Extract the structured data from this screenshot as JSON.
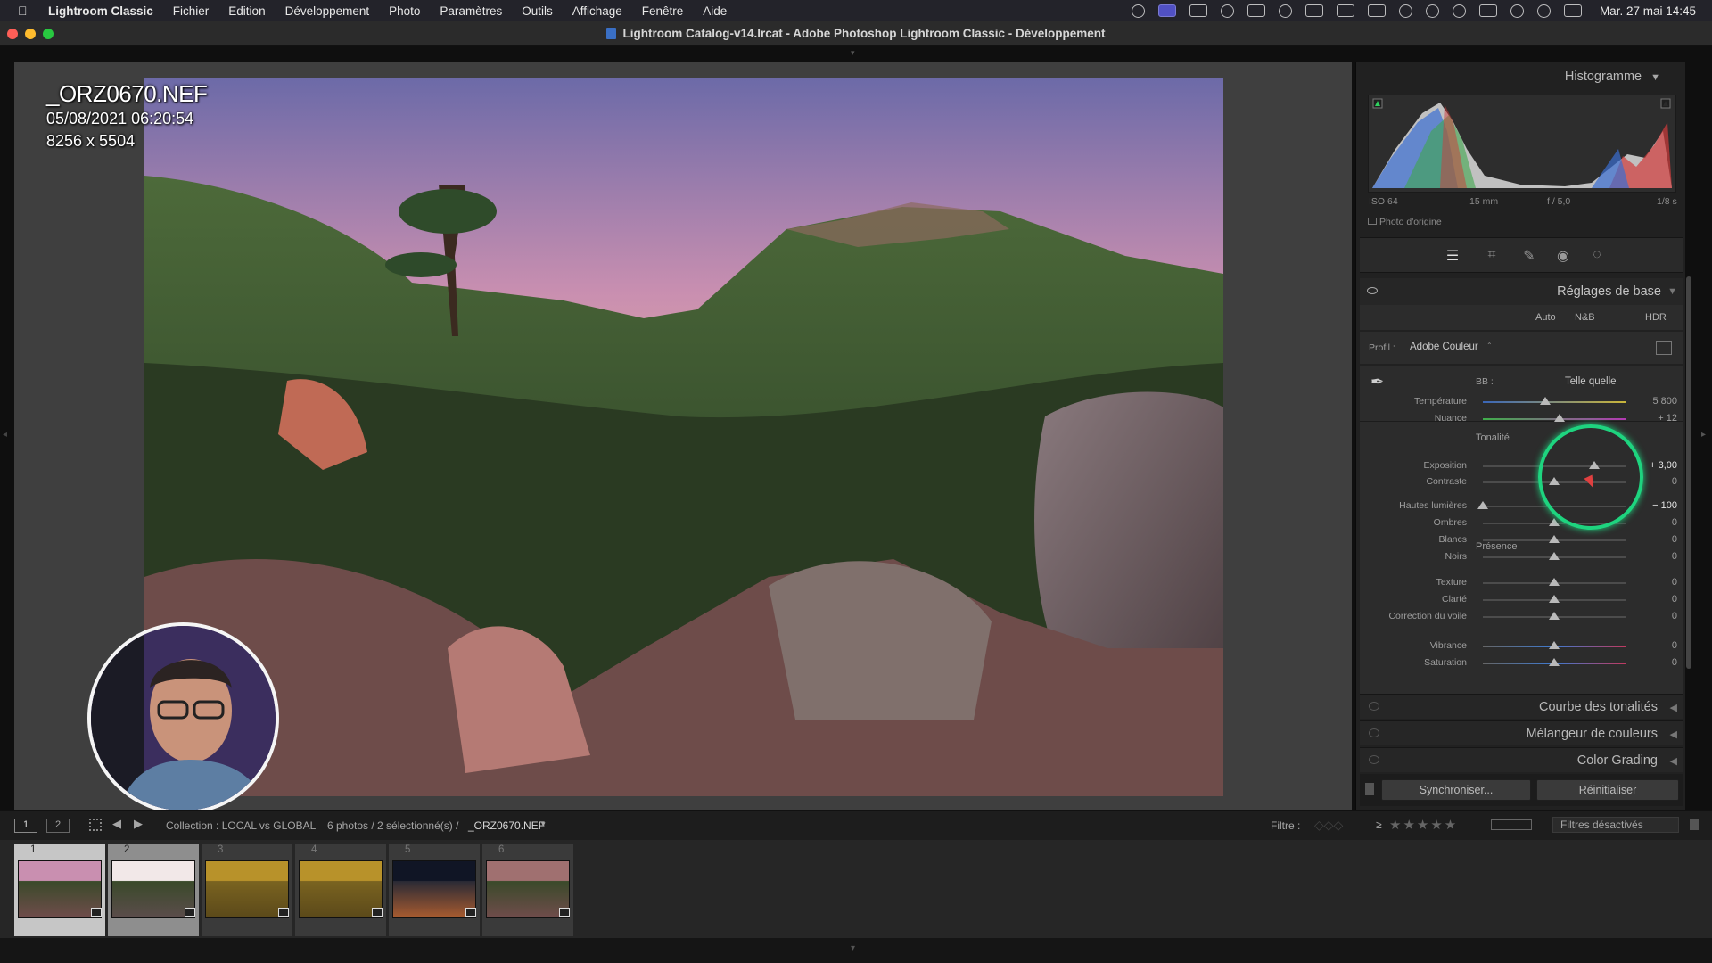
{
  "menubar": {
    "app": "Lightroom Classic",
    "items": [
      "Fichier",
      "Edition",
      "Développement",
      "Photo",
      "Paramètres",
      "Outils",
      "Affichage",
      "Fenêtre",
      "Aide"
    ],
    "clock": "Mar. 27 mai  14:45"
  },
  "window": {
    "title": "Lightroom Catalog-v14.lrcat - Adobe Photoshop Lightroom Classic - Développement"
  },
  "photo_info": {
    "filename": "_ORZ0670.NEF",
    "datetime": "05/08/2021 06:20:54",
    "dimensions": "8256 x 5504"
  },
  "histogram": {
    "title": "Histogramme",
    "iso": "ISO 64",
    "focal": "15 mm",
    "aperture": "f / 5,0",
    "shutter": "1/8 s",
    "original_label": "Photo d'origine"
  },
  "basic": {
    "title": "Réglages de base",
    "auto": "Auto",
    "nb": "N&B",
    "hdr": "HDR",
    "profile_label": "Profil :",
    "profile_value": "Adobe Couleur",
    "wb_label": "BB :",
    "wb_value": "Telle quelle",
    "tone_label": "Tonalité",
    "presence_label": "Présence",
    "sliders": [
      {
        "label": "Température",
        "value": "5 800",
        "pos": 0.44
      },
      {
        "label": "Nuance",
        "value": "+ 12",
        "pos": 0.54
      },
      {
        "label": "Exposition",
        "value": "+ 3,00",
        "pos": 0.78
      },
      {
        "label": "Contraste",
        "value": "0",
        "pos": 0.5
      },
      {
        "label": "Hautes lumières",
        "value": "− 100",
        "pos": 0.0
      },
      {
        "label": "Ombres",
        "value": "0",
        "pos": 0.5
      },
      {
        "label": "Blancs",
        "value": "0",
        "pos": 0.5
      },
      {
        "label": "Noirs",
        "value": "0",
        "pos": 0.5
      },
      {
        "label": "Texture",
        "value": "0",
        "pos": 0.5
      },
      {
        "label": "Clarté",
        "value": "0",
        "pos": 0.5
      },
      {
        "label": "Correction du voile",
        "value": "0",
        "pos": 0.5
      },
      {
        "label": "Vibrance",
        "value": "0",
        "pos": 0.5
      },
      {
        "label": "Saturation",
        "value": "0",
        "pos": 0.5
      }
    ]
  },
  "panels": {
    "tone_curve": "Courbe des tonalités",
    "color_mixer": "Mélangeur de couleurs",
    "color_grading": "Color Grading"
  },
  "buttons": {
    "sync": "Synchroniser...",
    "reset": "Réinitialiser"
  },
  "filmstrip": {
    "view1": "1",
    "view2": "2",
    "collection": "Collection : LOCAL vs GLOBAL",
    "count": "6 photos / 2 sélectionné(s) /",
    "current": "_ORZ0670.NEF",
    "filter_label": "Filtre :",
    "filter_value": "Filtres désactivés",
    "rating_op": "≥",
    "numbers": [
      "1",
      "2",
      "3",
      "4",
      "5",
      "6"
    ]
  },
  "colors": {
    "accent": "#1ed47f",
    "panel": "#2c2c2c"
  }
}
